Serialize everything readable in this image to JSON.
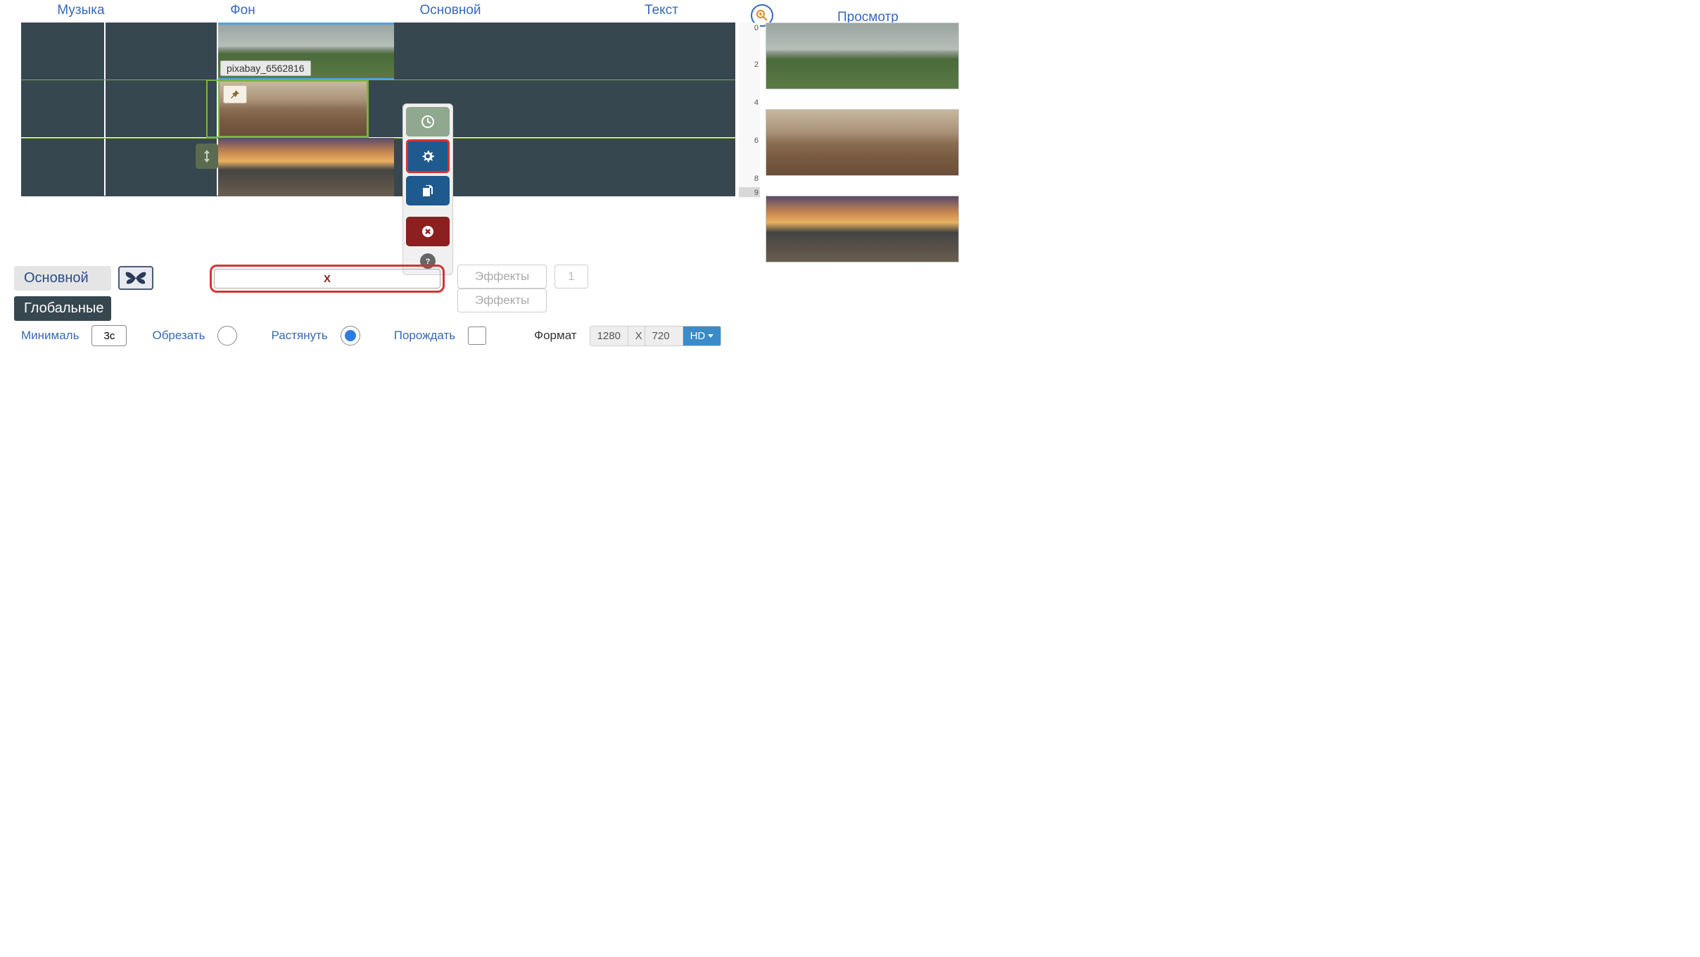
{
  "tabs": {
    "music": "Музыка",
    "background": "Фон",
    "main": "Основной",
    "text": "Текст",
    "preview": "Просмотр"
  },
  "clip": {
    "label": "pixabay_6562816"
  },
  "ruler": {
    "marks": [
      "0",
      "2",
      "4",
      "6",
      "8",
      "9"
    ]
  },
  "panel": {
    "tab_main": "Основной",
    "tab_global": "Глобальные",
    "x_label": "X",
    "effects": "Эффекты",
    "effects_num": "1",
    "min_label": "Минималь",
    "min_value": "3с",
    "crop": "Обрезать",
    "stretch": "Растянуть",
    "generate": "Порождать",
    "format": "Формат",
    "width": "1280",
    "sep": "X",
    "height": "720",
    "hd": "HD"
  }
}
